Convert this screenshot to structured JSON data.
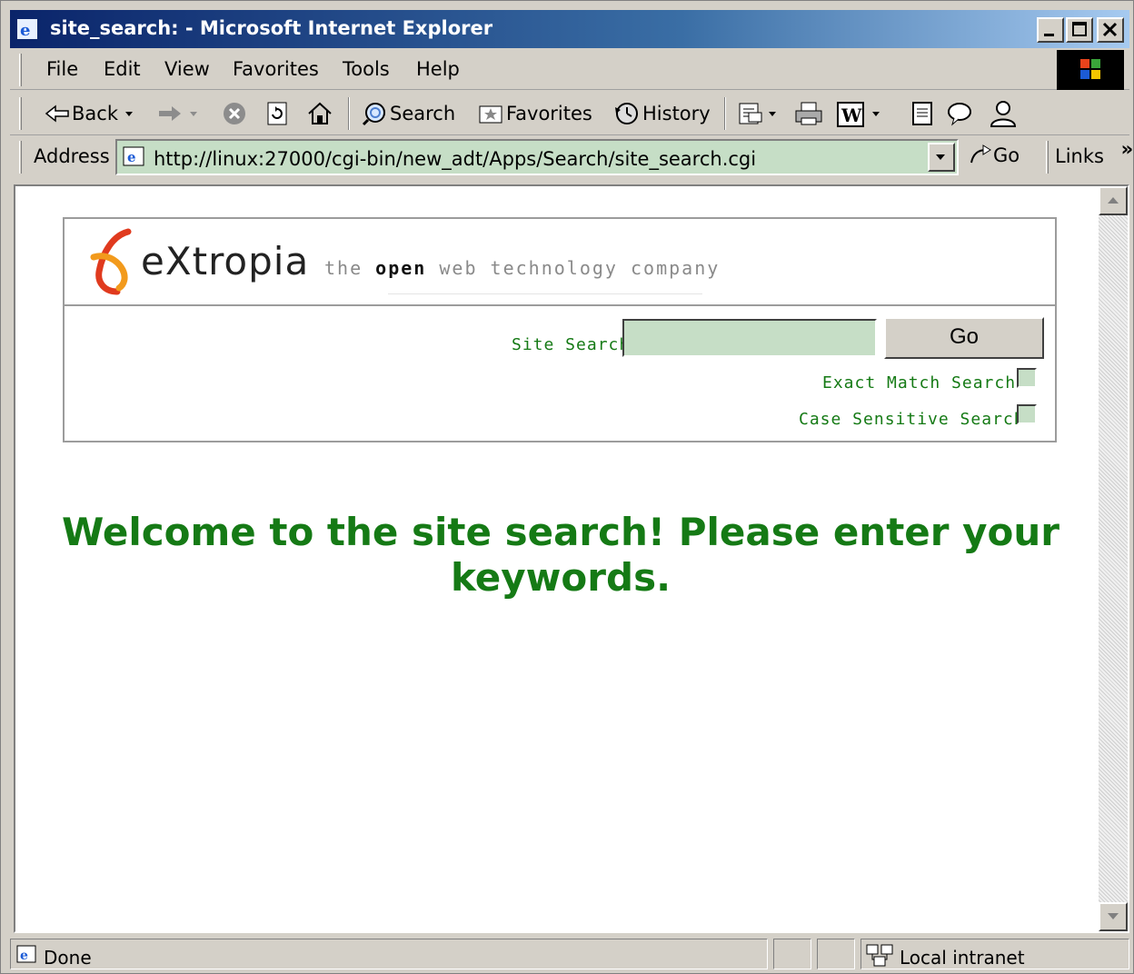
{
  "window": {
    "title": "site_search: - Microsoft Internet Explorer"
  },
  "menubar": {
    "items": [
      "File",
      "Edit",
      "View",
      "Favorites",
      "Tools",
      "Help"
    ]
  },
  "toolbar": {
    "back_label": "Back",
    "search_label": "Search",
    "favorites_label": "Favorites",
    "history_label": "History"
  },
  "addressbar": {
    "label": "Address",
    "url": "http://linux:27000/cgi-bin/new_adt/Apps/Search/site_search.cgi",
    "go_label": "Go",
    "links_label": "Links",
    "links_chevron": "»"
  },
  "page": {
    "logo_word": "eXtropia",
    "tagline_pre": "the ",
    "tagline_bold": "open",
    "tagline_post": " web technology company",
    "search_label": "Site Search",
    "search_value": "",
    "search_button": "Go",
    "exact_match_label": "Exact Match Search",
    "exact_match_checked": false,
    "case_sensitive_label": "Case Sensitive Search",
    "case_sensitive_checked": false,
    "welcome_message": "Welcome to the site search! Please enter your keywords."
  },
  "statusbar": {
    "status": "Done",
    "zone": "Local intranet"
  },
  "colors": {
    "accent_green": "#157a15",
    "field_bg": "#c6dec6",
    "chrome": "#d4d0c8",
    "titlebar": "#0a246a"
  }
}
